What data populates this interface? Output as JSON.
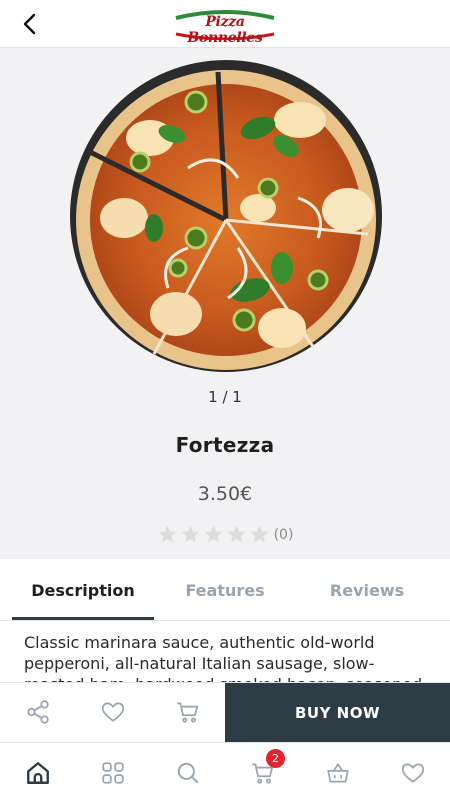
{
  "header": {
    "back_icon": "chevron-left-icon",
    "logo_text": "Pizza Bonnelles",
    "logo_colors": [
      "#2e8b3a",
      "#ffffff",
      "#c8161d"
    ]
  },
  "product": {
    "image_icon": "pizza-photo",
    "pager": "1 / 1",
    "name": "Fortezza",
    "price": "3.50€",
    "rating_stars": 0,
    "rating_max": 5,
    "rating_count": "(0)"
  },
  "tabs": [
    {
      "label": "Description",
      "active": true
    },
    {
      "label": "Features",
      "active": false
    },
    {
      "label": "Reviews",
      "active": false
    }
  ],
  "description": "Classic marinara sauce, authentic old-world pepperoni, all-natural Italian sausage, slow-roasted ham, hardwood smoked bacon, seasoned pork and beef.",
  "actions": {
    "share_icon": "share-icon",
    "wishlist_icon": "heart-icon",
    "cart_icon": "cart-icon",
    "buy_label": "BUY NOW"
  },
  "bottom_nav": {
    "items": [
      {
        "icon": "home-icon"
      },
      {
        "icon": "grid-icon"
      },
      {
        "icon": "search-icon"
      },
      {
        "icon": "cart-icon"
      },
      {
        "icon": "basket-icon"
      },
      {
        "icon": "heart-icon"
      }
    ],
    "cart_badge": "2"
  },
  "colors": {
    "accent": "#2e3d45",
    "badge": "#e0262c",
    "inactive_tab": "#9aa4ad",
    "hero_bg": "#f2f2f4"
  }
}
